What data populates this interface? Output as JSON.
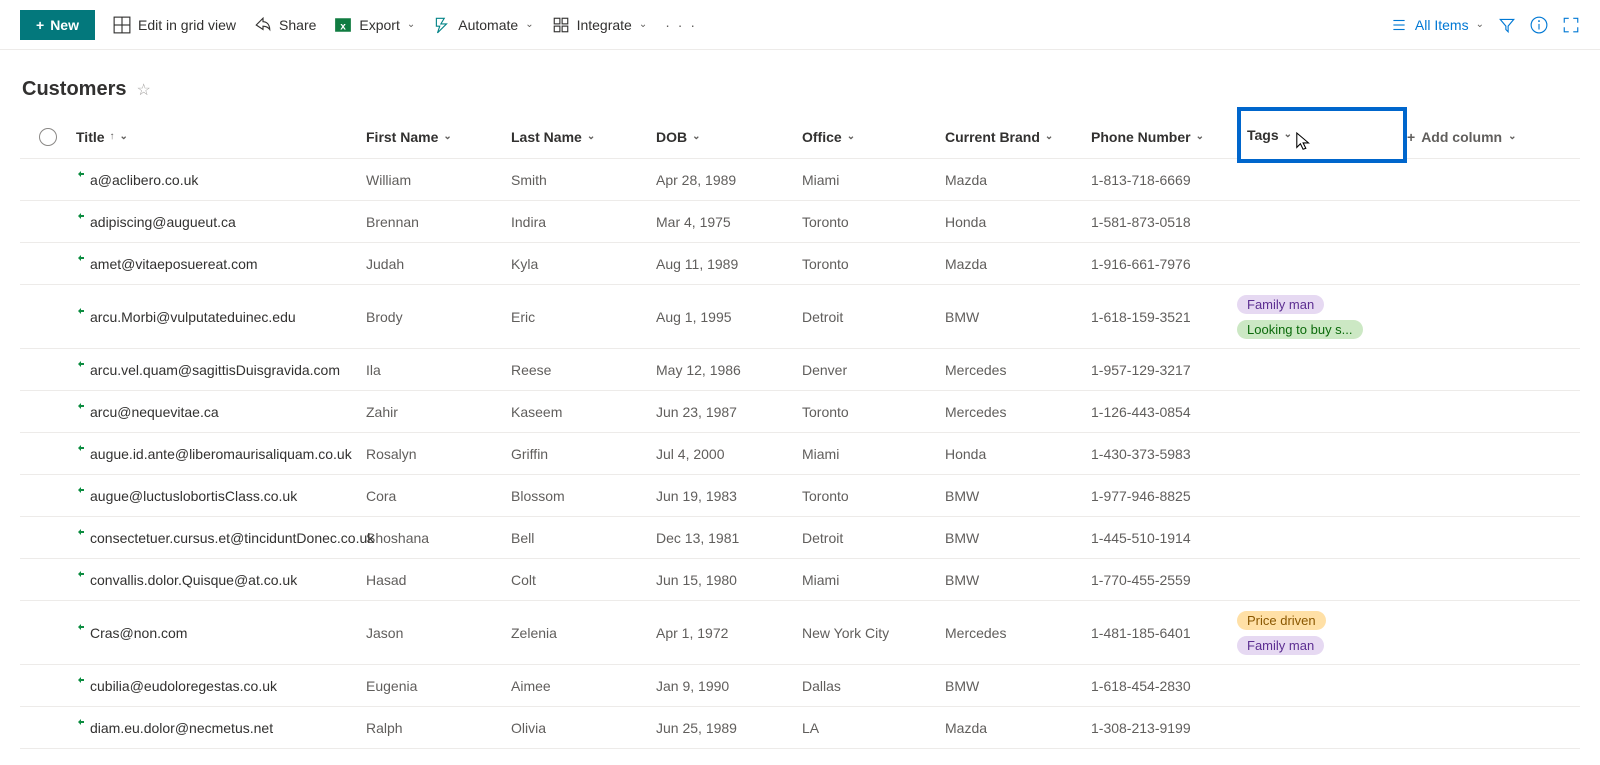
{
  "toolbar": {
    "new_label": "New",
    "edit_grid": "Edit in grid view",
    "share": "Share",
    "export": "Export",
    "automate": "Automate",
    "integrate": "Integrate",
    "all_items": "All Items"
  },
  "list": {
    "title": "Customers"
  },
  "columns": {
    "title": "Title",
    "first_name": "First Name",
    "last_name": "Last Name",
    "dob": "DOB",
    "office": "Office",
    "brand": "Current Brand",
    "phone": "Phone Number",
    "tags": "Tags",
    "add": "Add column"
  },
  "rows": [
    {
      "title": "a@aclibero.co.uk",
      "first": "William",
      "last": "Smith",
      "dob": "Apr 28, 1989",
      "office": "Miami",
      "brand": "Mazda",
      "phone": "1-813-718-6669",
      "tags": []
    },
    {
      "title": "adipiscing@augueut.ca",
      "first": "Brennan",
      "last": "Indira",
      "dob": "Mar 4, 1975",
      "office": "Toronto",
      "brand": "Honda",
      "phone": "1-581-873-0518",
      "tags": []
    },
    {
      "title": "amet@vitaeposuereat.com",
      "first": "Judah",
      "last": "Kyla",
      "dob": "Aug 11, 1989",
      "office": "Toronto",
      "brand": "Mazda",
      "phone": "1-916-661-7976",
      "tags": []
    },
    {
      "title": "arcu.Morbi@vulputateduinec.edu",
      "first": "Brody",
      "last": "Eric",
      "dob": "Aug 1, 1995",
      "office": "Detroit",
      "brand": "BMW",
      "phone": "1-618-159-3521",
      "tags": [
        {
          "text": "Family man",
          "c": "purple"
        },
        {
          "text": "Looking to buy s...",
          "c": "green"
        }
      ]
    },
    {
      "title": "arcu.vel.quam@sagittisDuisgravida.com",
      "first": "Ila",
      "last": "Reese",
      "dob": "May 12, 1986",
      "office": "Denver",
      "brand": "Mercedes",
      "phone": "1-957-129-3217",
      "tags": []
    },
    {
      "title": "arcu@nequevitae.ca",
      "first": "Zahir",
      "last": "Kaseem",
      "dob": "Jun 23, 1987",
      "office": "Toronto",
      "brand": "Mercedes",
      "phone": "1-126-443-0854",
      "tags": []
    },
    {
      "title": "augue.id.ante@liberomaurisaliquam.co.uk",
      "first": "Rosalyn",
      "last": "Griffin",
      "dob": "Jul 4, 2000",
      "office": "Miami",
      "brand": "Honda",
      "phone": "1-430-373-5983",
      "tags": []
    },
    {
      "title": "augue@luctuslobortisClass.co.uk",
      "first": "Cora",
      "last": "Blossom",
      "dob": "Jun 19, 1983",
      "office": "Toronto",
      "brand": "BMW",
      "phone": "1-977-946-8825",
      "tags": []
    },
    {
      "title": "consectetuer.cursus.et@tinciduntDonec.co.uk",
      "first": "Shoshana",
      "last": "Bell",
      "dob": "Dec 13, 1981",
      "office": "Detroit",
      "brand": "BMW",
      "phone": "1-445-510-1914",
      "tags": []
    },
    {
      "title": "convallis.dolor.Quisque@at.co.uk",
      "first": "Hasad",
      "last": "Colt",
      "dob": "Jun 15, 1980",
      "office": "Miami",
      "brand": "BMW",
      "phone": "1-770-455-2559",
      "tags": []
    },
    {
      "title": "Cras@non.com",
      "first": "Jason",
      "last": "Zelenia",
      "dob": "Apr 1, 1972",
      "office": "New York City",
      "brand": "Mercedes",
      "phone": "1-481-185-6401",
      "tags": [
        {
          "text": "Price driven",
          "c": "orange"
        },
        {
          "text": "Family man",
          "c": "purple"
        }
      ]
    },
    {
      "title": "cubilia@eudoloregestas.co.uk",
      "first": "Eugenia",
      "last": "Aimee",
      "dob": "Jan 9, 1990",
      "office": "Dallas",
      "brand": "BMW",
      "phone": "1-618-454-2830",
      "tags": []
    },
    {
      "title": "diam.eu.dolor@necmetus.net",
      "first": "Ralph",
      "last": "Olivia",
      "dob": "Jun 25, 1989",
      "office": "LA",
      "brand": "Mazda",
      "phone": "1-308-213-9199",
      "tags": []
    }
  ]
}
